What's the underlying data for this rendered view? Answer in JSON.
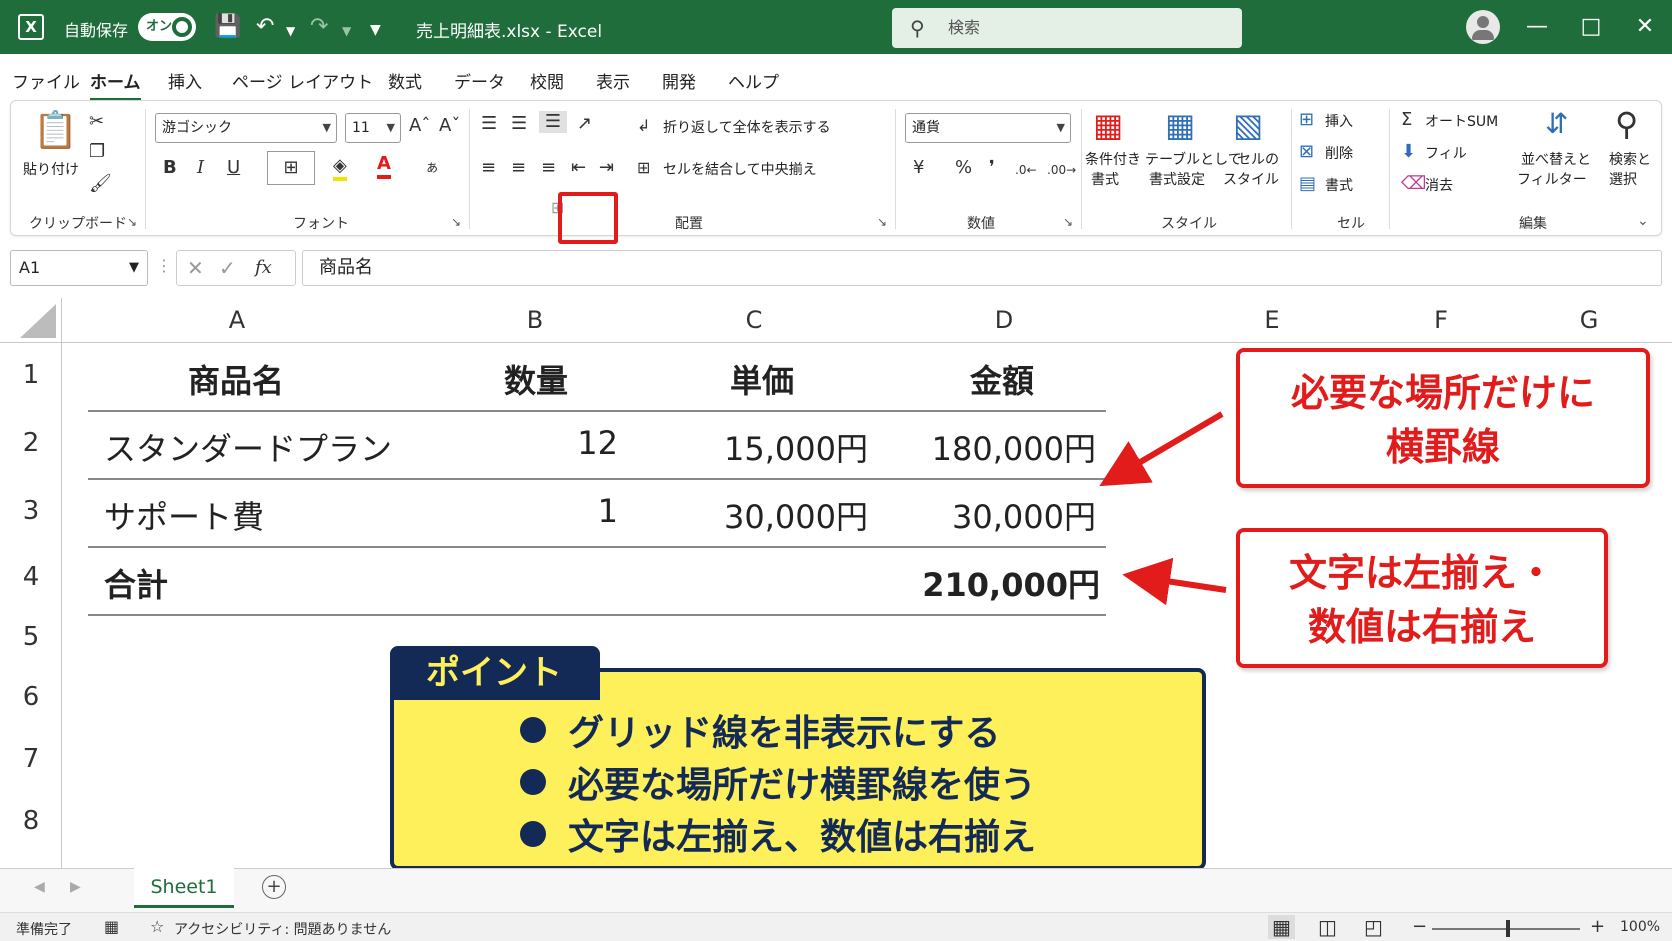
{
  "titlebar": {
    "logo": "X",
    "autosave_label": "自動保存",
    "toggle_label": "オン",
    "filename": "売上明細表.xlsx  -  Excel",
    "search_placeholder": "検索"
  },
  "menu_tabs": [
    "ファイル",
    "ホーム",
    "挿入",
    "ページ レイアウト",
    "数式",
    "データ",
    "校閲",
    "表示",
    "開発",
    "ヘルプ"
  ],
  "ribbon": {
    "clipboard": {
      "paste": "貼り付け",
      "label": "クリップボード"
    },
    "font": {
      "name": "游ゴシック",
      "size": "11",
      "bold": "B",
      "italic": "I",
      "underline": "U",
      "label": "フォント"
    },
    "alignment": {
      "wrap": "折り返して全体を表示する",
      "merge": "セルを結合して中央揃え",
      "label": "配置"
    },
    "number": {
      "format": "通貨",
      "label": "数値"
    },
    "styles": {
      "conditional": [
        "条件付き",
        "書式"
      ],
      "table": [
        "テーブルとして",
        "書式設定"
      ],
      "cell": [
        "セルの",
        "スタイル"
      ],
      "label": "スタイル"
    },
    "cells": {
      "insert": "挿入",
      "delete": "削除",
      "format": "書式",
      "label": "セル"
    },
    "editing": {
      "autosum": "オートSUM",
      "fill": "フィル",
      "clear": "消去",
      "sort": [
        "並べ替えと",
        "フィルター"
      ],
      "find": [
        "検索と",
        "選択"
      ],
      "label": "編集"
    },
    "colors": {
      "highlight": "#e21b1b",
      "accent": "#1e6d3b"
    }
  },
  "formula_bar": {
    "cell_ref": "A1",
    "fx": "fx",
    "content": "商品名"
  },
  "columns": [
    "A",
    "B",
    "C",
    "D",
    "E",
    "F",
    "G"
  ],
  "rows": [
    "1",
    "2",
    "3",
    "4",
    "5",
    "6",
    "7",
    "8"
  ],
  "table": {
    "header": [
      "商品名",
      "数量",
      "単価",
      "金額"
    ],
    "rows": [
      [
        "スタンダードプラン",
        "12",
        "15,000円",
        "180,000円"
      ],
      [
        "サポート費",
        "1",
        "30,000円",
        "30,000円"
      ]
    ],
    "total": {
      "label": "合計",
      "amount": "210,000円"
    }
  },
  "callouts": {
    "borders": [
      "必要な場所だけに",
      "横罫線"
    ],
    "alignment": [
      "文字は左揃え・",
      "数値は右揃え"
    ]
  },
  "point": {
    "title": "ポイント",
    "items": [
      "グリッド線を非表示にする",
      "必要な場所だけ横罫線を使う",
      "文字は左揃え、数値は右揃え"
    ]
  },
  "sheet": {
    "name": "Sheet1"
  },
  "status": {
    "ready": "準備完了",
    "accessibility": "アクセシビリティ: 問題ありません",
    "zoom": "100%"
  }
}
